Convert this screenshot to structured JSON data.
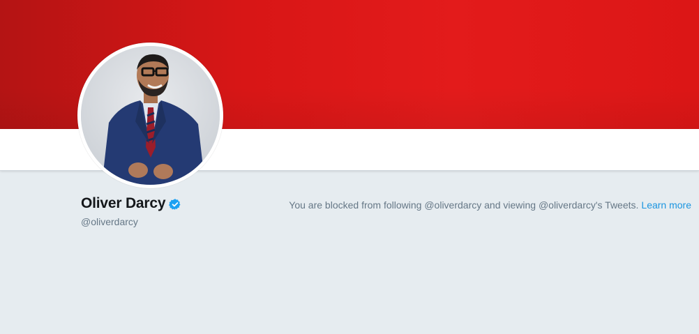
{
  "profile": {
    "name": "Oliver Darcy",
    "handle": "@oliverdarcy",
    "verified_icon": "verified-badge-icon",
    "avatar_alt": "profile-photo"
  },
  "notice": {
    "text": "You are blocked from following @oliverdarcy and viewing @oliverdarcy's Tweets.",
    "link": "Learn more"
  },
  "colors": {
    "banner": "#dc1616",
    "background": "#e6ecf0",
    "link": "#1b95e0",
    "verified": "#1da1f2"
  }
}
